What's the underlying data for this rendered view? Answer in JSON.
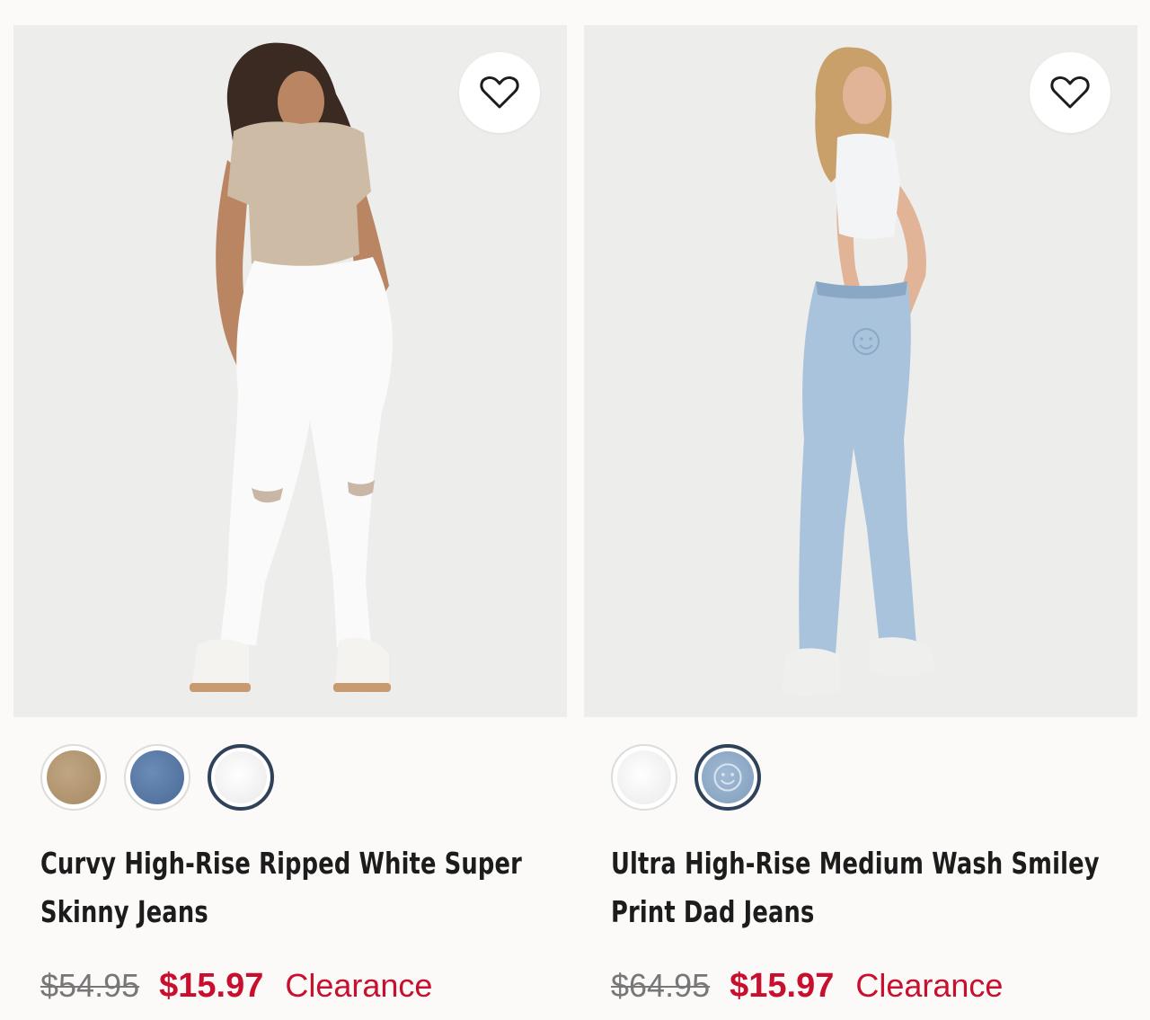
{
  "products": [
    {
      "title": "Curvy High-Rise Ripped White Super Skinny Jeans",
      "original_price": "$54.95",
      "sale_price": "$15.97",
      "badge": "Clearance",
      "wishlist_icon": "heart-outline-icon",
      "swatches": [
        {
          "name": "tan",
          "color": "#b69a73",
          "selected": false
        },
        {
          "name": "medium-blue",
          "color": "#5577a3",
          "selected": false
        },
        {
          "name": "white",
          "color": "#f4f4f4",
          "selected": true
        }
      ]
    },
    {
      "title": "Ultra High-Rise Medium Wash Smiley Print Dad Jeans",
      "original_price": "$64.95",
      "sale_price": "$15.97",
      "badge": "Clearance",
      "wishlist_icon": "heart-outline-icon",
      "swatches": [
        {
          "name": "white",
          "color": "#f4f4f4",
          "selected": false
        },
        {
          "name": "light-blue-smiley",
          "color": "#8eaac7",
          "selected": true
        }
      ]
    }
  ],
  "colors": {
    "sale_red": "#c8102e",
    "selected_ring": "#2f4259",
    "photo_bg": "#ededeb"
  }
}
